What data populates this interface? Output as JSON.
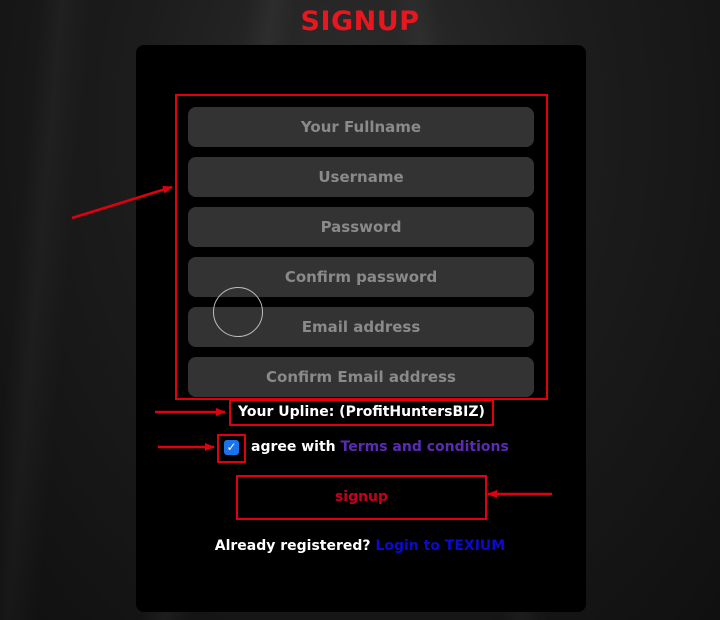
{
  "page": {
    "title": "SIGNUP"
  },
  "form": {
    "fullname_placeholder": "Your Fullname",
    "username_placeholder": "Username",
    "password_placeholder": "Password",
    "confirm_password_placeholder": "Confirm password",
    "email_placeholder": "Email address",
    "confirm_email_placeholder": "Confirm Email address",
    "upline_text": "Your Upline: (ProfitHuntersBIZ)",
    "agree_text": "agree with ",
    "terms_link": "Terms and conditions",
    "terms_checked": true,
    "signup_label": "signup",
    "already_registered_text": "Already registered? ",
    "login_link": "Login to TEXIUM"
  },
  "colors": {
    "title": "#e8161e",
    "highlight_border": "#e0000f",
    "terms_link": "#5b2bb5",
    "login_link": "#0a0ad0",
    "signup_label": "#c4001d"
  }
}
